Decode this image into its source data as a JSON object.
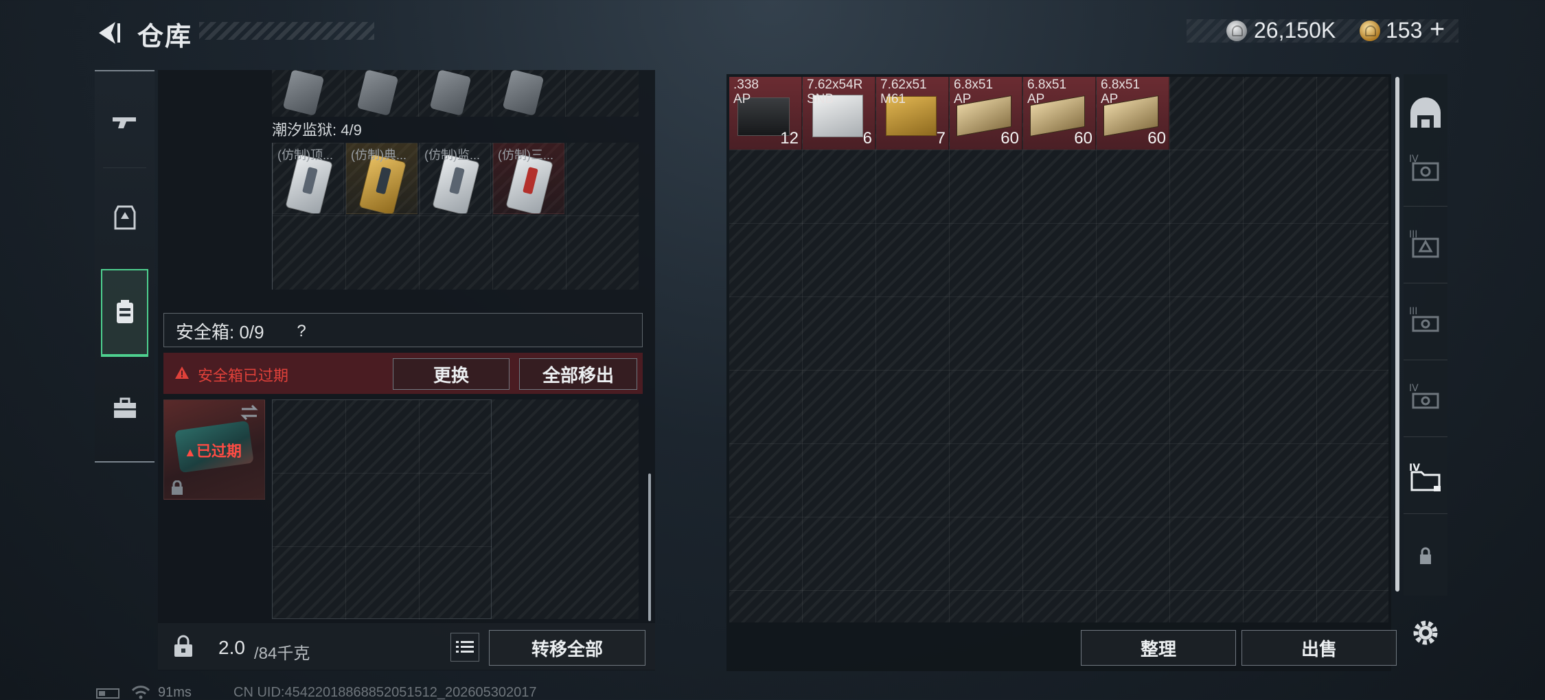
{
  "header": {
    "title": "仓库",
    "silver_amount": "26,150K",
    "gold_amount": "153",
    "add_label": "+"
  },
  "left_panel": {
    "tide_prison_label": "潮汐监狱: 4/9",
    "tide_items": [
      {
        "label": "(仿制)顶...",
        "style": "silver"
      },
      {
        "label": "(仿制)典...",
        "style": "gold"
      },
      {
        "label": "(仿制)监...",
        "style": "silver"
      },
      {
        "label": "(仿制)三...",
        "style": "red"
      }
    ],
    "safe_box": {
      "title": "安全箱: 0/9",
      "help": "?",
      "warning": "安全箱已过期",
      "replace_label": "更换",
      "move_all_out_label": "全部移出",
      "expired_label": "已过期"
    },
    "weight": {
      "current": "2.0",
      "max": "/84千克"
    },
    "transfer_all_label": "转移全部"
  },
  "storage": {
    "ammo": [
      {
        "caliber": ".338",
        "type": "AP",
        "count": "12",
        "box": "black"
      },
      {
        "caliber": "7.62x54R",
        "type": "SNB",
        "count": "6",
        "box": "white"
      },
      {
        "caliber": "7.62x51",
        "type": "M61",
        "count": "7",
        "box": "gold"
      },
      {
        "caliber": "6.8x51",
        "type": "AP",
        "count": "60",
        "box": "tan"
      },
      {
        "caliber": "6.8x51",
        "type": "AP",
        "count": "60",
        "box": "tan"
      },
      {
        "caliber": "6.8x51",
        "type": "AP",
        "count": "60",
        "box": "tan"
      }
    ],
    "sort_label": "整理",
    "sell_label": "出售"
  },
  "status_bar": {
    "ping": "91ms",
    "uid": "CN UID:454220188688520515​12_202605302017"
  },
  "colors": {
    "accent_green": "#4ed08f",
    "warning_red": "#e0413a",
    "item_red": "#6b2c32"
  }
}
